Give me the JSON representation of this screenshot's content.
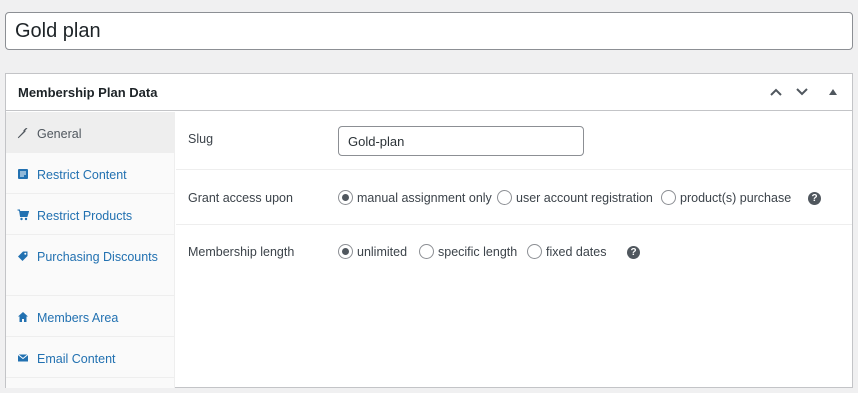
{
  "post": {
    "title": "Gold plan"
  },
  "panel": {
    "title": "Membership Plan Data"
  },
  "tabs": [
    {
      "label": "General",
      "icon": "wrench-icon",
      "active": true
    },
    {
      "label": "Restrict Content",
      "icon": "document-icon",
      "active": false
    },
    {
      "label": "Restrict Products",
      "icon": "cart-icon",
      "active": false
    },
    {
      "label": "Purchasing Discounts",
      "icon": "tag-icon",
      "active": false
    },
    {
      "label": "Members Area",
      "icon": "home-icon",
      "active": false
    },
    {
      "label": "Email Content",
      "icon": "envelope-icon",
      "active": false
    }
  ],
  "general": {
    "slug_label": "Slug",
    "slug_value": "Gold-plan",
    "grant_label": "Grant access upon",
    "grant_options": [
      {
        "label": "manual assignment only",
        "checked": true
      },
      {
        "label": "user account registration",
        "checked": false
      },
      {
        "label": "product(s) purchase",
        "checked": false
      }
    ],
    "length_label": "Membership length",
    "length_options": [
      {
        "label": "unlimited",
        "checked": true
      },
      {
        "label": "specific length",
        "checked": false
      },
      {
        "label": "fixed dates",
        "checked": false
      }
    ],
    "help_glyph": "?"
  },
  "colors": {
    "link": "#2271b1",
    "border": "#c3c4c7",
    "background": "#f0f0f1"
  }
}
